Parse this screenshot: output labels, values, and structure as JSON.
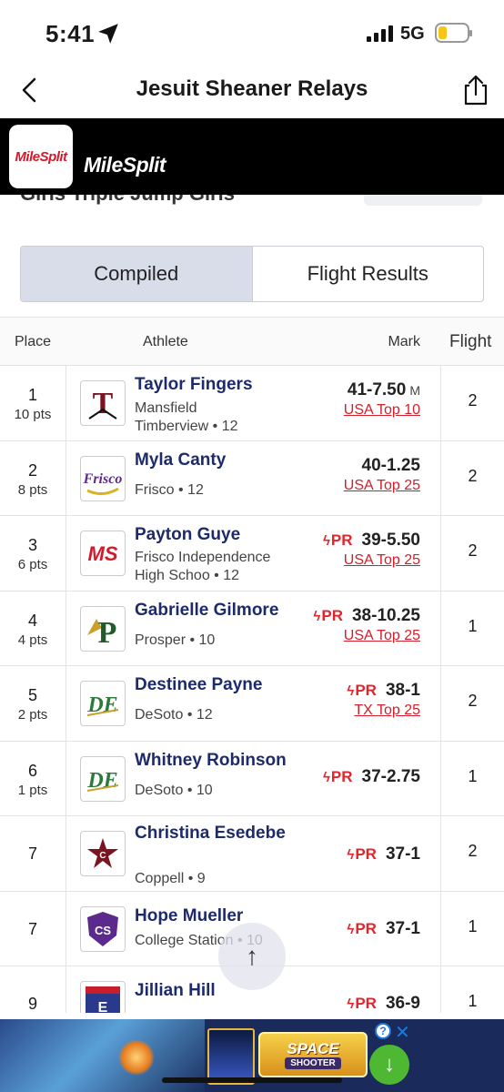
{
  "status_bar": {
    "time": "5:41",
    "network": "5G",
    "icons": [
      "location-arrow-icon",
      "signal-bars-icon",
      "battery-low-icon"
    ],
    "battery_color": "#f5c518"
  },
  "nav": {
    "title": "Jesuit Sheaner Relays",
    "icons": [
      "chevron-left-icon",
      "share-icon"
    ]
  },
  "brand": {
    "logo_text": "MileSplit",
    "name": "MileSplit",
    "accent": "#d5192a"
  },
  "event": {
    "title": "Girls Triple Jump Girls"
  },
  "tabs": [
    {
      "label": "Compiled",
      "active": true
    },
    {
      "label": "Flight Results",
      "active": false
    }
  ],
  "table": {
    "headers": {
      "place": "Place",
      "athlete": "Athlete",
      "mark": "Mark",
      "flight": "Flight"
    },
    "rows": [
      {
        "place": "1",
        "points": "10 pts",
        "name": "Taylor Fingers",
        "school": "Mansfield Timberview",
        "grade": "12",
        "school_line": "Timberview • 12",
        "school_pre": "Mansfield",
        "pr": "",
        "mark": "41-7.50",
        "unit": "M",
        "rank": "USA Top 10",
        "flight": "2",
        "logo": "T"
      },
      {
        "place": "2",
        "points": "8 pts",
        "name": "Myla Canty",
        "school_line": "Frisco • 12",
        "pr": "",
        "mark": "40-1.25",
        "unit": "",
        "rank": "USA Top 25",
        "flight": "2",
        "logo": "Frisco"
      },
      {
        "place": "3",
        "points": "6 pts",
        "name": "Payton Guye",
        "school_pre": "Frisco Independence",
        "school_line": "High Schoo • 12",
        "pr": "PR",
        "mark": "39-5.50",
        "unit": "",
        "rank": "USA Top 25",
        "flight": "2",
        "logo": "MS"
      },
      {
        "place": "4",
        "points": "4 pts",
        "name": "Gabrielle Gilmore",
        "school_line": "Prosper • 10",
        "pr": "PR",
        "mark": "38-10.25",
        "unit": "",
        "rank": "USA Top 25",
        "flight": "1",
        "logo": "P"
      },
      {
        "place": "5",
        "points": "2 pts",
        "name": "Destinee Payne",
        "school_line": "DeSoto • 12",
        "pr": "PR",
        "mark": "38-1",
        "unit": "",
        "rank": "TX Top 25",
        "flight": "2",
        "logo": "DE"
      },
      {
        "place": "6",
        "points": "1 pts",
        "name": "Whitney Robinson",
        "school_line": "DeSoto • 10",
        "pr": "PR",
        "mark": "37-2.75",
        "unit": "",
        "rank": "",
        "flight": "1",
        "logo": "DE"
      },
      {
        "place": "7",
        "points": "",
        "name": "Christina Esedebe",
        "school_line": "Coppell • 9",
        "pr": "PR",
        "mark": "37-1",
        "unit": "",
        "rank": "",
        "flight": "2",
        "logo": "C"
      },
      {
        "place": "7",
        "points": "",
        "name": "Hope Mueller",
        "school_line": "College Station • 10",
        "pr": "PR",
        "mark": "37-1",
        "unit": "",
        "rank": "",
        "flight": "1",
        "logo": "CS"
      },
      {
        "place": "9",
        "points": "",
        "name": "Jillian Hill",
        "school_line": "",
        "pr": "PR",
        "mark": "36-9",
        "unit": "",
        "rank": "",
        "flight": "1",
        "logo": "E"
      }
    ]
  },
  "scroll_top_icon": "arrow-up-icon",
  "ad": {
    "title": "SPACE",
    "subtitle": "SHOOTER",
    "info_label": "?",
    "close_label": "✕",
    "download_icon": "download-arrow-icon"
  },
  "colors": {
    "name_blue": "#1d2a6b",
    "pr_red": "#e0262c",
    "rank_red": "#d21f2b",
    "tab_active": "#d9dce9"
  }
}
